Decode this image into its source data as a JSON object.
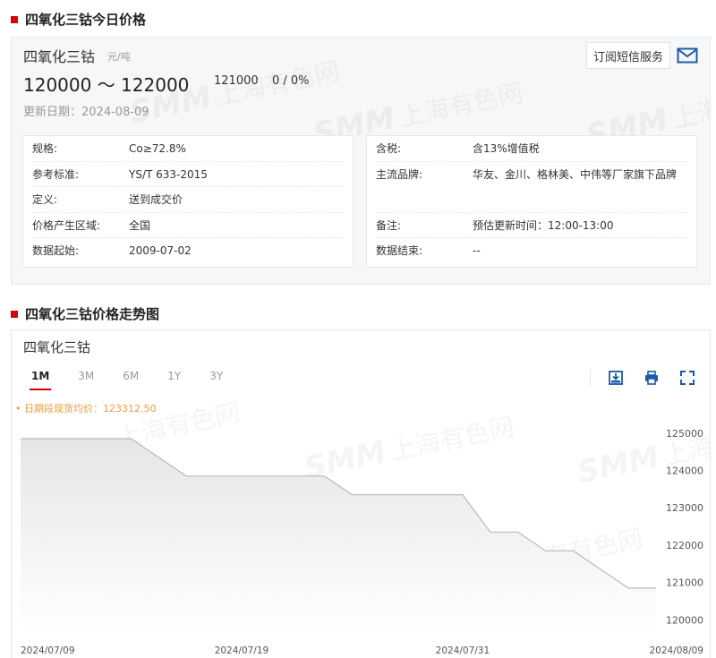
{
  "section1": {
    "title": "四氧化三钴今日价格"
  },
  "product": {
    "name": "四氧化三钴",
    "unit": "元/吨",
    "price_range": "120000 ～ 122000",
    "mid_price": "121000",
    "change": "0 / 0%",
    "update_label": "更新日期",
    "update_date": "2024-08-09",
    "subscribe_label": "订阅短信服务"
  },
  "watermark": {
    "logo": "SMM",
    "text": "上海有色网"
  },
  "specs_left": [
    {
      "k": "规格:",
      "v": "Co≥72.8%"
    },
    {
      "k": "参考标准:",
      "v": "YS/T 633-2015"
    },
    {
      "k": "定义:",
      "v": "送到成交价"
    },
    {
      "k": "价格产生区域:",
      "v": "全国"
    },
    {
      "k": "数据起始:",
      "v": "2009-07-02"
    }
  ],
  "specs_right": [
    {
      "k": "含税:",
      "v": "含13%增值税"
    },
    {
      "k": "主流品牌:",
      "v": "华友、金川、格林美、中伟等厂家旗下品牌"
    },
    {
      "k": "备注:",
      "v": "预估更新时间：12:00-13:00"
    },
    {
      "k": "数据结束:",
      "v": "--"
    }
  ],
  "section2": {
    "title": "四氧化三钴价格走势图"
  },
  "chart_panel": {
    "title": "四氧化三钴",
    "tabs": [
      "1M",
      "3M",
      "6M",
      "1Y",
      "3Y"
    ],
    "active_tab": "1M",
    "avg_text": "• 日期段现货均价：123312.50",
    "icons": [
      "download-image-icon",
      "print-icon",
      "fullscreen-icon"
    ]
  },
  "chart_data": {
    "type": "area",
    "x": [
      "2024-07-09",
      "2024-07-10",
      "2024-07-11",
      "2024-07-12",
      "2024-07-15",
      "2024-07-16",
      "2024-07-17",
      "2024-07-18",
      "2024-07-19",
      "2024-07-22",
      "2024-07-23",
      "2024-07-24",
      "2024-07-25",
      "2024-07-26",
      "2024-07-29",
      "2024-07-30",
      "2024-07-31",
      "2024-08-01",
      "2024-08-02",
      "2024-08-05",
      "2024-08-06",
      "2024-08-07",
      "2024-08-08",
      "2024-08-09"
    ],
    "y": [
      124850,
      124850,
      124850,
      124850,
      124850,
      124350,
      123850,
      123850,
      123850,
      123850,
      123850,
      123850,
      123350,
      123350,
      123350,
      123350,
      123350,
      122350,
      122350,
      121850,
      121850,
      121350,
      120850,
      120850
    ],
    "x_tick_labels": [
      "2024/07/09",
      "2024/07/19",
      "2024/07/31",
      "2024/08/09"
    ],
    "y_ticks": [
      120000,
      121000,
      122000,
      123000,
      124000,
      125000
    ],
    "ylim": [
      119650,
      125450
    ],
    "grid": false,
    "y_axis_side": "right",
    "line_color": "#b9b9b9",
    "fill_color": "#e6e6e6"
  },
  "colors": {
    "accent": "#d7000f",
    "avg": "#f39a3c",
    "icon": "#1a5aa6"
  }
}
